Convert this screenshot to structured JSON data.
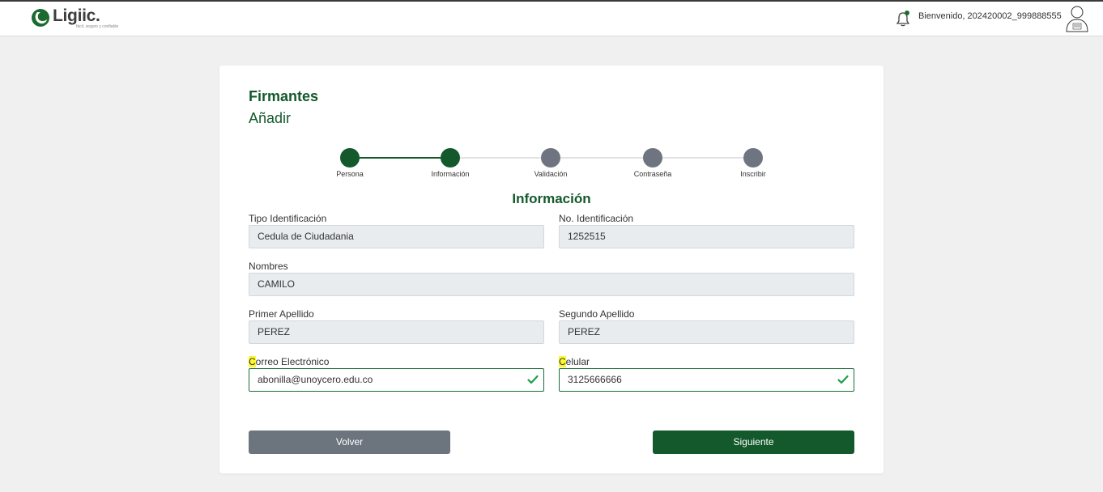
{
  "header": {
    "logo_text": "Ligiic.",
    "logo_tagline": "fácil, seguro y confiable",
    "welcome_text": "Bienvenido, 202420002_999888555"
  },
  "page": {
    "title": "Firmantes",
    "subtitle": "Añadir",
    "section_title": "Información"
  },
  "stepper": {
    "steps": [
      {
        "label": "Persona",
        "state": "done"
      },
      {
        "label": "Información",
        "state": "active"
      },
      {
        "label": "Validación",
        "state": "pending"
      },
      {
        "label": "Contraseña",
        "state": "pending"
      },
      {
        "label": "Inscribir",
        "state": "pending"
      }
    ]
  },
  "form": {
    "tipo_identificacion": {
      "label": "Tipo Identificación",
      "value": "Cedula de Ciudadania"
    },
    "no_identificacion": {
      "label": "No. Identificación",
      "value": "1252515"
    },
    "nombres": {
      "label": "Nombres",
      "value": "CAMILO"
    },
    "primer_apellido": {
      "label": "Primer Apellido",
      "value": "PEREZ"
    },
    "segundo_apellido": {
      "label": "Segundo Apellido",
      "value": "PEREZ"
    },
    "correo": {
      "label_first": "C",
      "label_rest": "orreo Electrónico",
      "value": "abonilla@unoycero.edu.co"
    },
    "celular": {
      "label_first": "C",
      "label_rest": "elular",
      "value": "3125666666"
    }
  },
  "buttons": {
    "back": "Volver",
    "next": "Siguiente"
  },
  "colors": {
    "brand_green": "#13592b",
    "pending_gray": "#6e7580",
    "check_green": "#1e9e4a",
    "highlight": "#fbf834"
  },
  "icons": {
    "bell": "bell-icon",
    "avatar": "user-avatar-icon",
    "check": "check-icon"
  }
}
